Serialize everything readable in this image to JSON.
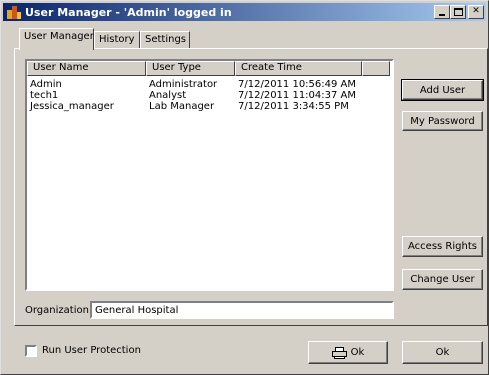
{
  "window": {
    "title": "User Manager - 'Admin' logged in",
    "icon": "app-bar-icon"
  },
  "tabs": [
    {
      "label": "User Manager",
      "active": true
    },
    {
      "label": "History",
      "active": false
    },
    {
      "label": "Settings",
      "active": false
    }
  ],
  "users_list": {
    "columns": [
      "User Name",
      "User Type",
      "Create Time"
    ],
    "rows": [
      {
        "name": "Admin",
        "type": "Administrator",
        "created": "7/12/2011 10:56:49 AM"
      },
      {
        "name": "tech1",
        "type": "Analyst",
        "created": "7/12/2011 11:04:37 AM"
      },
      {
        "name": "Jessica_manager",
        "type": "Lab Manager",
        "created": "7/12/2011 3:34:55 PM"
      }
    ]
  },
  "buttons": {
    "add_user": "Add User",
    "my_password": "My Password",
    "access_rights": "Access Rights",
    "change_user": "Change User",
    "print_ok": "Ok",
    "ok": "Ok"
  },
  "organization": {
    "label": "Organization:",
    "value": "General Hospital"
  },
  "protection": {
    "label": "Run User Protection",
    "checked": false
  },
  "colors": {
    "title_start": "#0a246a",
    "title_end": "#a6caf0",
    "face": "#d4d0c8"
  }
}
